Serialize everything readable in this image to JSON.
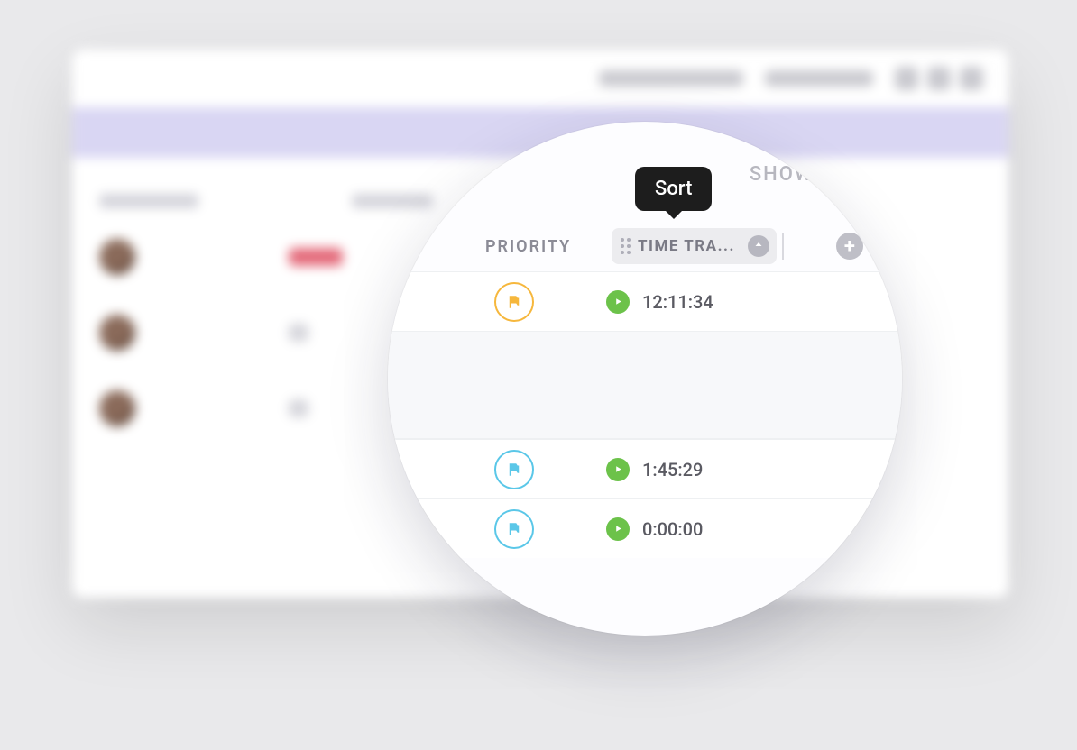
{
  "tooltip": {
    "label": "Sort"
  },
  "header_links": {
    "show_closed": "SHOW CL"
  },
  "columns": {
    "priority": "PRIORITY",
    "time_tracked": "TIME TRA..."
  },
  "icons": {
    "add_column": "+",
    "sort_direction": "up"
  },
  "tasks": [
    {
      "priority_color": "orange",
      "time": "12:11:34"
    },
    {
      "priority_color": "blue",
      "time": "1:45:29"
    },
    {
      "priority_color": "blue",
      "time": "0:00:00"
    }
  ],
  "colors": {
    "flag_orange": "#f6b73c",
    "flag_blue": "#5ac7e8",
    "play_green": "#6cc24a",
    "tooltip_bg": "#1d1d1d"
  }
}
